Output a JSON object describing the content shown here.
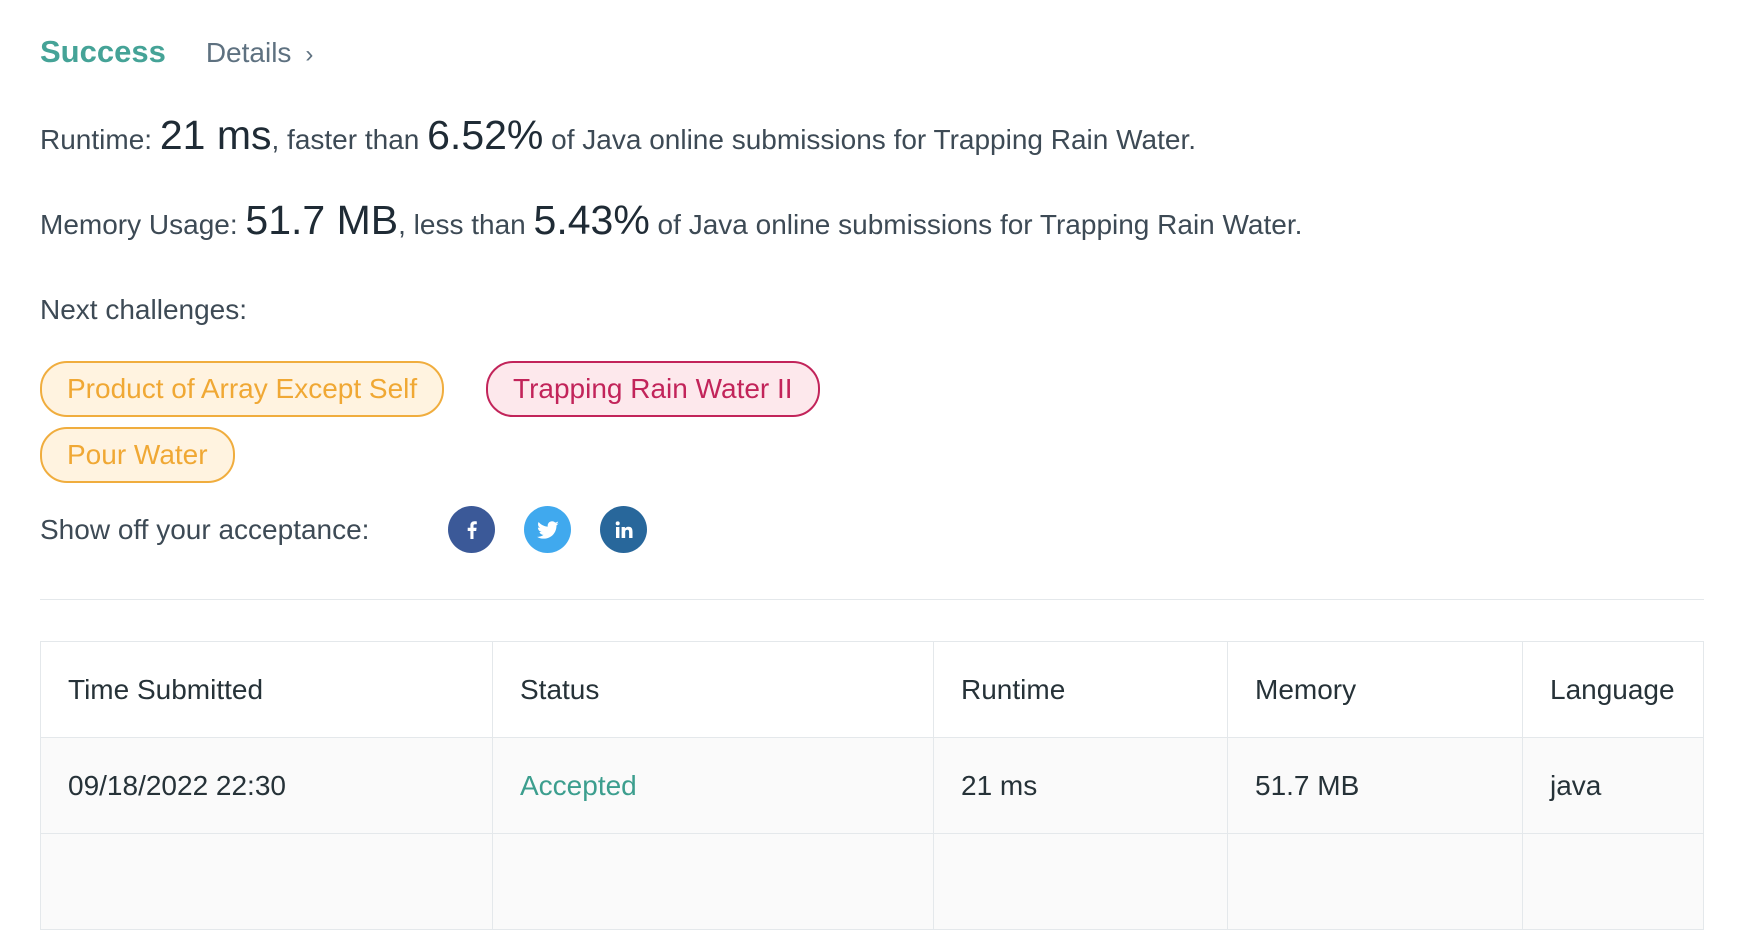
{
  "result": {
    "status": "Success",
    "details_label": "Details",
    "details_chevron": "›"
  },
  "runtime": {
    "label": "Runtime: ",
    "value": "21 ms",
    "connector": ", faster than ",
    "percent": "6.52%",
    "suffix": " of Java online submissions for Trapping Rain Water."
  },
  "memory": {
    "label": "Memory Usage: ",
    "value": "51.7 MB",
    "connector": ", less than ",
    "percent": "5.43%",
    "suffix": " of Java online submissions for Trapping Rain Water."
  },
  "next_challenges": {
    "label": "Next challenges:",
    "items": [
      {
        "title": "Product of Array Except Self",
        "difficulty": "medium",
        "color": "#f0a834"
      },
      {
        "title": "Trapping Rain Water II",
        "difficulty": "hard",
        "color": "#c2245a"
      },
      {
        "title": "Pour Water",
        "difficulty": "medium",
        "color": "#f0a834"
      }
    ]
  },
  "share": {
    "label": "Show off your acceptance:",
    "networks": [
      {
        "icon": "facebook-icon",
        "color": "#3b5998"
      },
      {
        "icon": "twitter-icon",
        "color": "#40a9ee"
      },
      {
        "icon": "linkedin-icon",
        "color": "#28679b"
      }
    ]
  },
  "submissions": {
    "columns": [
      "Time Submitted",
      "Status",
      "Runtime",
      "Memory",
      "Language"
    ],
    "rows": [
      [
        "09/18/2022 22:30",
        "Accepted",
        "21 ms",
        "51.7 MB",
        "java"
      ]
    ]
  },
  "colors": {
    "success": "#45a397",
    "accepted": "#3c9e8e",
    "medium": "#f0a834",
    "hard": "#c2245a"
  }
}
